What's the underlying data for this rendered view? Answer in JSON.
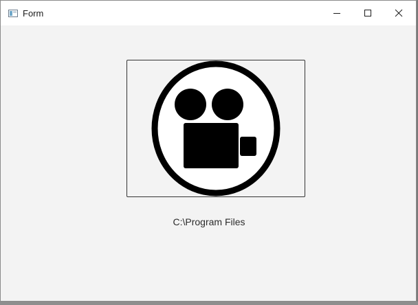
{
  "window": {
    "title": "Form",
    "app_icon": "form-window-icon",
    "controls": {
      "minimize_icon": "minimize-icon",
      "maximize_icon": "maximize-icon",
      "close_icon": "close-icon"
    }
  },
  "content": {
    "image_icon": "video-camera-icon",
    "path_text": "C:\\Program Files"
  }
}
